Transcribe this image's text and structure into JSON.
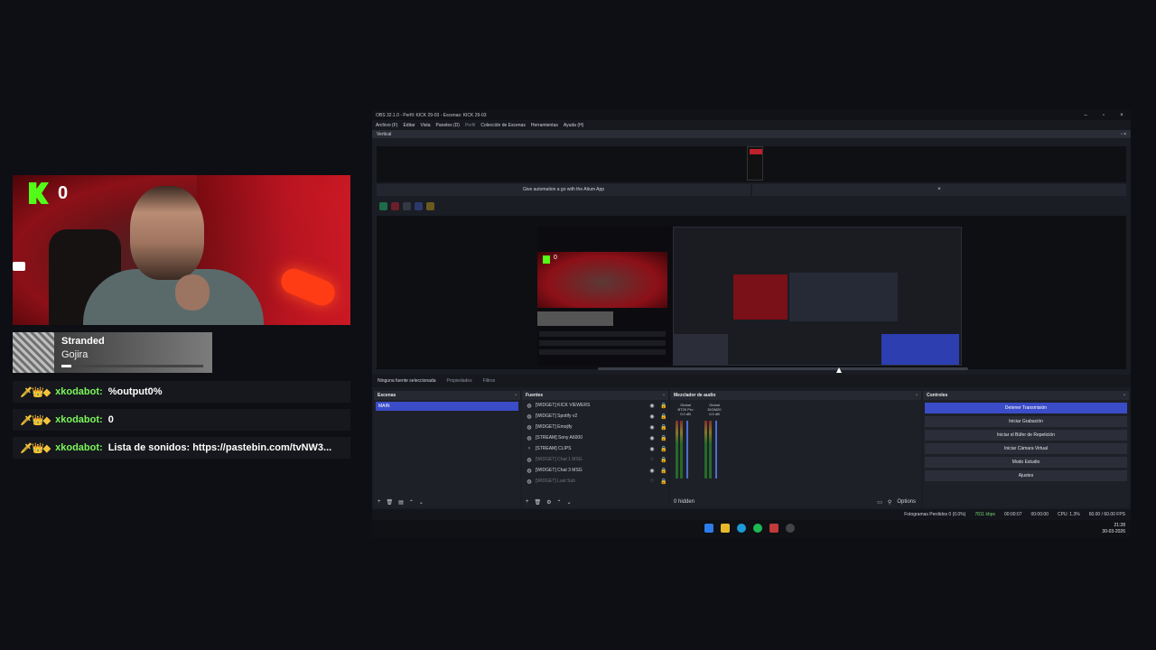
{
  "overlay": {
    "kick_count": "0",
    "now_playing": {
      "title": "Stranded",
      "artist": "Gojira",
      "progress": 0.07
    },
    "chat": [
      {
        "user": "xkodabot:",
        "message": "%output0%"
      },
      {
        "user": "xkodabot:",
        "message": "0"
      },
      {
        "user": "xkodabot:",
        "message": "Lista de sonidos: https://pastebin.com/tvNW3..."
      }
    ]
  },
  "obs": {
    "window_title": "OBS 32.1.0 - Perfil: KICK 29-03 - Escenas: KICK 29-03",
    "menu": [
      "Archivo (F)",
      "Editar",
      "Vista",
      "Paneles (D)",
      "Perfil",
      "Colección de Escenas",
      "Herramientas",
      "Ayuda (H)"
    ],
    "vertical_label": "Vertical",
    "banner": "Give automation a go with the Aitum App",
    "no_source": "Ninguna fuente seleccionada",
    "props_tab": "Propiedades",
    "filters_tab": "Filtros",
    "scenes": {
      "title": "Escenas",
      "items": [
        "MAIN"
      ]
    },
    "sources": {
      "title": "Fuentes",
      "items": [
        {
          "name": "[WIDGET] KICK VIEWERS",
          "dim": false
        },
        {
          "name": "[WIDGET] Spotify v2",
          "dim": false
        },
        {
          "name": "[WIDGET] Emojify",
          "dim": false
        },
        {
          "name": "[STREAM] Sony A6000",
          "dim": false
        },
        {
          "name": "[STREAM] CLIPS",
          "dim": false
        },
        {
          "name": "[WIDGET] Chat 1 MSG",
          "dim": true
        },
        {
          "name": "[WIDGET] Chat 3 MSG",
          "dim": false
        },
        {
          "name": "[WIDGET] Last Sub",
          "dim": true
        }
      ]
    },
    "mixer": {
      "title": "Mezclador de audio",
      "channels": [
        {
          "label": "Global",
          "device": "BT20 Pro",
          "db": "0.0 dB"
        },
        {
          "label": "Global",
          "device": "DIGM20",
          "db": "0.0 dB"
        }
      ],
      "hidden": "0 hidden",
      "options": "Options"
    },
    "controls": {
      "title": "Controles",
      "buttons": [
        "Detener Transmisión",
        "Iniciar Grabación",
        "Iniciar el Búfer de Repetición",
        "Iniciar Cámara Virtual",
        "Modo Estudio",
        "Ajustes"
      ]
    },
    "status": {
      "dropped": "Fotogramas Perdidos 0 (0.0%)",
      "bitrate": "7811 kbps",
      "live_time": "00:00:07",
      "rec_time": "00:00:00",
      "cpu": "CPU: 1.3%",
      "fps": "60.00 / 60.00 FPS"
    }
  },
  "taskbar": {
    "time": "21:28",
    "date": "30-03-2026"
  },
  "colors": {
    "kick_green": "#53fc18",
    "obs_accent": "#3a4cc7",
    "chat_user": "#7cf55a"
  }
}
